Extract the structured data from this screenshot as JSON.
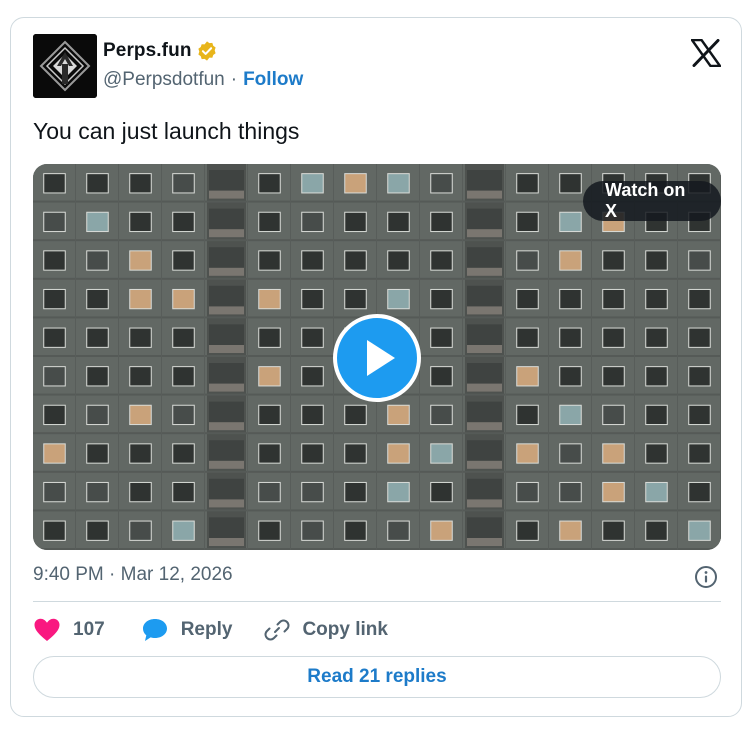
{
  "author": {
    "name": "Perps.fun",
    "handle": "@Perpsdotfun",
    "separator": "·",
    "follow_label": "Follow",
    "avatar_icon": "perps-logo-icon",
    "verified_icon": "gold-verified-badge-icon"
  },
  "platform_icon": "x-logo-icon",
  "tweet": {
    "text": "You can just launch things"
  },
  "media": {
    "type": "video",
    "watch_label": "Watch on X",
    "play_icon": "play-icon"
  },
  "meta": {
    "timestamp": "9:40 PM · Mar 12, 2026",
    "info_icon": "info-icon"
  },
  "actions": {
    "like_count": "107",
    "reply_label": "Reply",
    "copy_label": "Copy link"
  },
  "read_replies_label": "Read 21 replies",
  "colors": {
    "accent": "#1d9bf0",
    "link": "#1d7bc9",
    "like": "#f91880",
    "verified": "#e8b51b",
    "muted": "#536471",
    "border": "#cfd9de"
  }
}
